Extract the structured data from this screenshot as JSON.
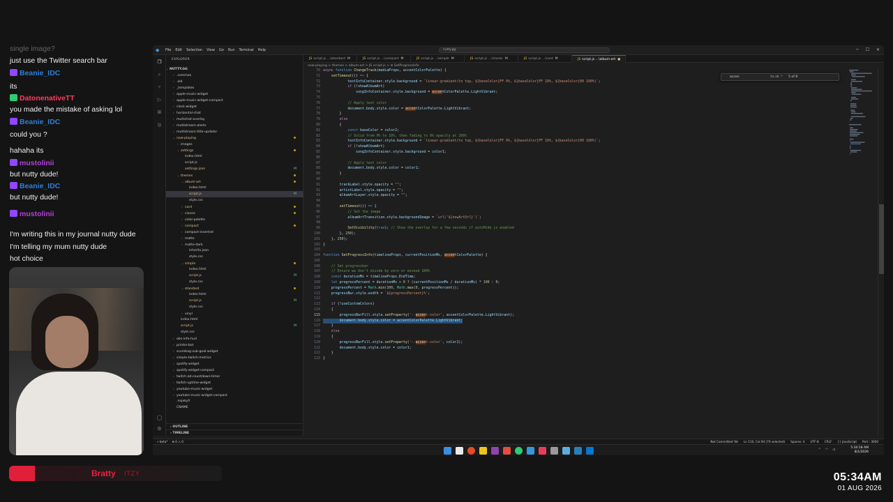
{
  "chat": {
    "messages": [
      {
        "user": "",
        "text": "single image?",
        "faded": true
      },
      {
        "user": "",
        "text": "just use the Twitter search bar"
      },
      {
        "user": "Beanie_IDC",
        "color": "#2e7fd9",
        "text": ""
      },
      {
        "user": "",
        "text": "its"
      },
      {
        "user": "DatonenativeTT",
        "color": "#ff3b5c",
        "text": ""
      },
      {
        "user": "",
        "text": "you made the mistake of asking lol"
      },
      {
        "user": "Beanie_IDC",
        "color": "#2e7fd9",
        "text": ""
      },
      {
        "user": "",
        "text": "could you ?"
      },
      {
        "user": "",
        "text": "hahaha its"
      },
      {
        "user": "mustolinii",
        "color": "#b43fd9",
        "text": ""
      },
      {
        "user": "",
        "text": "but nutty dude!"
      },
      {
        "user": "Beanie_IDC",
        "color": "#2e7fd9",
        "text": ""
      },
      {
        "user": "",
        "text": "but nutty dude!"
      },
      {
        "user": "mustolinii",
        "color": "#b43fd9",
        "text": ""
      },
      {
        "user": "",
        "text": "I'm writing this in my journal nutty dude"
      },
      {
        "user": "",
        "text": "I'm telling my mum nutty dude"
      },
      {
        "user": "",
        "text": "hot choice"
      }
    ]
  },
  "music": {
    "song": "Bratty",
    "artist": "ITZY"
  },
  "clock": {
    "time": "05:34AM",
    "date": "01 AUG 2026"
  },
  "vscode": {
    "menu": [
      "File",
      "Edit",
      "Selection",
      "View",
      "Go",
      "Run",
      "Terminal",
      "Help"
    ],
    "command_center": "nutty.gg",
    "explorer_title": "EXPLORER",
    "workspace": "NUTTY.GG",
    "tree": [
      {
        "label": ".common",
        "depth": 1,
        "folder": true
      },
      {
        "label": ".old",
        "depth": 1,
        "folder": true
      },
      {
        "label": "_templates",
        "depth": 1,
        "folder": true
      },
      {
        "label": "apple-music-widget",
        "depth": 1,
        "folder": true
      },
      {
        "label": "apple-music-widget-compact",
        "depth": 1,
        "folder": true
      },
      {
        "label": "clock-widget",
        "depth": 1,
        "folder": true
      },
      {
        "label": "horizontal-chat",
        "depth": 1,
        "folder": true
      },
      {
        "label": "multichat-overlay",
        "depth": 1,
        "folder": true
      },
      {
        "label": "multistream-alerts",
        "depth": 1,
        "folder": true
      },
      {
        "label": "multistream-title-updater",
        "depth": 1,
        "folder": true
      },
      {
        "label": "now-playing",
        "depth": 1,
        "folder": true,
        "open": true,
        "modified": true
      },
      {
        "label": "images",
        "depth": 2,
        "folder": true
      },
      {
        "label": "settings",
        "depth": 2,
        "folder": true,
        "open": true,
        "modified": true
      },
      {
        "label": "index.html",
        "depth": 3
      },
      {
        "label": "script.js",
        "depth": 3
      },
      {
        "label": "settings.json",
        "depth": 3,
        "modified": true,
        "badge": "M"
      },
      {
        "label": "themes",
        "depth": 2,
        "folder": true,
        "open": true,
        "modified": true
      },
      {
        "label": "album-art",
        "depth": 3,
        "folder": true,
        "open": true,
        "modified": true
      },
      {
        "label": "index.html",
        "depth": 4
      },
      {
        "label": "script.js",
        "depth": 4,
        "modified": true,
        "badge": "M",
        "selected": true
      },
      {
        "label": "style.css",
        "depth": 4
      },
      {
        "label": "card",
        "depth": 3,
        "folder": true,
        "modified": true
      },
      {
        "label": "classic",
        "depth": 3,
        "folder": true,
        "modified": true
      },
      {
        "label": "color-palette",
        "depth": 3,
        "folder": true
      },
      {
        "label": "compact",
        "depth": 3,
        "folder": true,
        "modified": true
      },
      {
        "label": "compact-inverted",
        "depth": 3,
        "folder": true
      },
      {
        "label": "matte",
        "depth": 3,
        "folder": true
      },
      {
        "label": "matte-dark",
        "depth": 3,
        "folder": true
      },
      {
        "label": "inherits.json",
        "depth": 4
      },
      {
        "label": "style.css",
        "depth": 4
      },
      {
        "label": "simple",
        "depth": 3,
        "folder": true,
        "open": true,
        "modified": true
      },
      {
        "label": "index.html",
        "depth": 4
      },
      {
        "label": "script.js",
        "depth": 4,
        "modified": true,
        "badge": "M"
      },
      {
        "label": "style.css",
        "depth": 4
      },
      {
        "label": "standard",
        "depth": 3,
        "folder": true,
        "open": true,
        "modified": true
      },
      {
        "label": "index.html",
        "depth": 4
      },
      {
        "label": "script.js",
        "depth": 4,
        "modified": true,
        "badge": "M"
      },
      {
        "label": "style.css",
        "depth": 4
      },
      {
        "label": "vinyl",
        "depth": 3,
        "folder": true
      },
      {
        "label": "index.html",
        "depth": 2
      },
      {
        "label": "script.js",
        "depth": 2,
        "modified": true,
        "badge": "M"
      },
      {
        "label": "style.css",
        "depth": 2
      },
      {
        "label": "obs-info-hud",
        "depth": 1,
        "folder": true
      },
      {
        "label": "printer-bot",
        "depth": 1,
        "folder": true
      },
      {
        "label": "scumbag-sub-goal-widget",
        "depth": 1,
        "folder": true
      },
      {
        "label": "simple-twitch-metrics",
        "depth": 1,
        "folder": true
      },
      {
        "label": "spotify-widget",
        "depth": 1,
        "folder": true
      },
      {
        "label": "spotify-widget-compact",
        "depth": 1,
        "folder": true
      },
      {
        "label": "twitch-ad-countdown-timer",
        "depth": 1,
        "folder": true
      },
      {
        "label": "twitch-uptime-widget",
        "depth": 1,
        "folder": true
      },
      {
        "label": "youtube-music-widget",
        "depth": 1,
        "folder": true
      },
      {
        "label": "youtube-music-widget-compact",
        "depth": 1,
        "folder": true
      },
      {
        "label": ".nojekyll",
        "depth": 1
      },
      {
        "label": "CNAME",
        "depth": 1
      }
    ],
    "outline_label": "OUTLINE",
    "timeline_label": "TIMELINE",
    "tabs": [
      {
        "label": "script.js",
        "path": "...\\standard",
        "mark": "M"
      },
      {
        "label": "script.js",
        "path": "...\\compact",
        "mark": "M"
      },
      {
        "label": "script.js",
        "path": "...\\simple",
        "mark": "M"
      },
      {
        "label": "script.js",
        "path": "...\\classic",
        "mark": "M"
      },
      {
        "label": "script.js",
        "path": "...\\card",
        "mark": "M"
      },
      {
        "label": "script.js",
        "path": "...\\album-art",
        "mark": "●",
        "active": true
      }
    ],
    "breadcrumb": "now-playing > themes > album-art > JS script.js > ⊘ SetProgressInfo",
    "find": {
      "query": "accen",
      "count": "5 of 8",
      "options": "Aa ab .*"
    },
    "status_left": [
      "⑂ beta*",
      "⊗ 0 ⚠ 0"
    ],
    "status_right": [
      "Not Committed Yet",
      "Ln 110, Col 94 (70 selected)",
      "Spaces: 4",
      "UTF-8",
      "CRLF",
      "{} JavaScript",
      "Port : 3000"
    ],
    "tray_time": "5:34:18 AM",
    "tray_date": "8/1/2026"
  },
  "code": [
    {
      "ln": "70",
      "html": "<span class='k'>async</span> <span class='b'>function</span> <span class='f'>ChangeTrack</span>(<span class='v'>mediaProps</span>, <span class='v'>accentColorPalette</span>) {"
    },
    {
      "ln": "71",
      "html": "    <span class='f'>setTimeout</span>(() <span class='b'>=&gt;</span> {"
    },
    {
      "ln": "72",
      "html": "            <span class='v'>textInfoContainer</span>.<span class='v'>style</span>.<span class='v'>background</span> = <span class='s'>`linear-gradient(to top, ${baseColor}FF 0%, ${baseColor}FF 10%, ${baseColor}00 100%)`</span>;"
    },
    {
      "ln": "73",
      "html": "            <span class='k'>if</span> (!<span class='v'>showAlbumArt</span>)"
    },
    {
      "ln": "74",
      "html": "                <span class='v'>songInfoContainer</span>.<span class='v'>style</span>.<span class='v'>background</span> = <span class='hl'>accen</span><span class='v'>tColorPalette</span>.<span class='v'>LightVibrant</span>;"
    },
    {
      "ln": "75",
      "html": ""
    },
    {
      "ln": "76",
      "html": "            <span class='c'>// Apply text color</span>"
    },
    {
      "ln": "77",
      "html": "            <span class='v'>document</span>.<span class='v'>body</span>.<span class='v'>style</span>.<span class='v'>color</span> = <span class='hl'>accen</span><span class='v'>tColorPalette</span>.<span class='v'>LightVibrant</span>;"
    },
    {
      "ln": "78",
      "html": "        }"
    },
    {
      "ln": "79",
      "html": "        <span class='k'>else</span>"
    },
    {
      "ln": "80",
      "html": "        {"
    },
    {
      "ln": "81",
      "html": "            <span class='b'>const</span> <span class='v'>baseColor</span> = <span class='v'>color2</span>;"
    },
    {
      "ln": "82",
      "html": "            <span class='c'>// Solid from 0% to 10%, then fading to 0% opacity at 100%</span>"
    },
    {
      "ln": "83",
      "html": "            <span class='v'>textInfoContainer</span>.<span class='v'>style</span>.<span class='v'>background</span> = <span class='s'>`linear-gradient(to top, ${baseColor}FF 0%, ${baseColor}FF 10%, ${baseColor}00 100%)`</span>;"
    },
    {
      "ln": "84",
      "html": "            <span class='k'>if</span> (!<span class='v'>showAlbumArt</span>)"
    },
    {
      "ln": "85",
      "html": "                <span class='v'>songInfoContainer</span>.<span class='v'>style</span>.<span class='v'>background</span> = <span class='v'>color1</span>;"
    },
    {
      "ln": "86",
      "html": ""
    },
    {
      "ln": "87",
      "html": "            <span class='c'>// Apply text color</span>"
    },
    {
      "ln": "88",
      "html": "            <span class='v'>document</span>.<span class='v'>body</span>.<span class='v'>style</span>.<span class='v'>color</span> = <span class='v'>color1</span>;"
    },
    {
      "ln": "89",
      "html": "        }"
    },
    {
      "ln": "90",
      "html": ""
    },
    {
      "ln": "91",
      "html": "        <span class='v'>trackLabel</span>.<span class='v'>style</span>.<span class='v'>opacity</span> = <span class='s'>\"\"</span>;"
    },
    {
      "ln": "92",
      "html": "        <span class='v'>artistLabel</span>.<span class='v'>style</span>.<span class='v'>opacity</span> = <span class='s'>\"\"</span>;"
    },
    {
      "ln": "93",
      "html": "        <span class='v'>albumArtLayer</span>.<span class='v'>style</span>.<span class='v'>opacity</span> = <span class='s'>\"\"</span>;"
    },
    {
      "ln": "94",
      "html": ""
    },
    {
      "ln": "95",
      "html": "        <span class='f'>setTimeout</span>(() <span class='b'>=&gt;</span> {"
    },
    {
      "ln": "96",
      "html": "            <span class='c'>// Set the image</span>"
    },
    {
      "ln": "97",
      "html": "            <span class='v'>albumArtTransition</span>.<span class='v'>style</span>.<span class='v'>backgroundImage</span> = <span class='s'>`url('${newArtUrl}')`</span>;"
    },
    {
      "ln": "98",
      "html": ""
    },
    {
      "ln": "99",
      "html": "            <span class='f'>SetVisibility</span>(<span class='b'>true</span>); <span class='c'>// Show the overlay for a few seconds if autoHide is enabled</span>"
    },
    {
      "ln": "100",
      "html": "        }, <span class='n'>250</span>);"
    },
    {
      "ln": "101",
      "html": "    }, <span class='n'>250</span>);"
    },
    {
      "ln": "102",
      "html": "}"
    },
    {
      "ln": "103",
      "html": ""
    },
    {
      "ln": "104",
      "html": "<span class='b'>function</span> <span class='f'>SetProgressInfo</span>(<span class='v'>timelineProps</span>, <span class='v'>currentPositionMs</span>, <span class='hl'>accen</span><span class='v'>tColorPalette</span>) {"
    },
    {
      "ln": "105",
      "html": ""
    },
    {
      "ln": "106",
      "html": "    <span class='c'>// Set progressbar</span>"
    },
    {
      "ln": "107",
      "html": "    <span class='c'>// Ensure we don't divide by zero or exceed 100%</span>"
    },
    {
      "ln": "108",
      "html": "    <span class='b'>const</span> <span class='v'>durationMs</span> = <span class='v'>timelineProps</span>.<span class='v'>EndTime</span>;"
    },
    {
      "ln": "109",
      "html": "    <span class='b'>let</span> <span class='v'>progressPercent</span> = <span class='v'>durationMs</span> &gt; <span class='n'>0</span> ? (<span class='v'>currentPositionMs</span> / <span class='v'>durationMs</span>) * <span class='n'>100</span> : <span class='n'>0</span>;"
    },
    {
      "ln": "110",
      "html": "    <span class='v'>progressPercent</span> = <span class='t'>Math</span>.<span class='f'>min</span>(<span class='n'>100</span>, <span class='t'>Math</span>.<span class='f'>max</span>(<span class='n'>0</span>, <span class='v'>progressPercent</span>));"
    },
    {
      "ln": "111",
      "html": "    <span class='v'>progressBar</span>.<span class='v'>style</span>.<span class='v'>width</span> = <span class='s'>`${progressPercent}%`</span>;"
    },
    {
      "ln": "112",
      "html": ""
    },
    {
      "ln": "113",
      "html": "    <span class='k'>if</span> (!<span class='v'>useCustomColors</span>)"
    },
    {
      "ln": "114",
      "html": "    {"
    },
    {
      "ln": "115",
      "html": "        <span class='v'>progressBarFill</span>.<span class='v'>style</span>.<span class='f'>setProperty</span>(<span class='s'>'--</span><span class='hl'>accen</span><span class='s'>t-color'</span>, <span class='v'>accentColorPalette</span>.<span class='v'>LightVibrant</span>);"
    },
    {
      "ln": "116",
      "html": "        <span class='v'>document</span>.<span class='v'>body</span>.<span class='v'>style</span>.<span class='v'>color</span> = <span class='v'>accentColorPalette</span>.<span class='v'>LightVibrant</span>;",
      "sel": true
    },
    {
      "ln": "117",
      "html": "    }"
    },
    {
      "ln": "118",
      "html": "    <span class='k'>else</span>"
    },
    {
      "ln": "119",
      "html": "    {"
    },
    {
      "ln": "120",
      "html": "        <span class='v'>progressBarFill</span>.<span class='v'>style</span>.<span class='f'>setProperty</span>(<span class='s'>'--</span><span class='hl'>accen</span><span class='s'>t-color'</span>, <span class='v'>color1</span>);"
    },
    {
      "ln": "121",
      "html": "        <span class='v'>document</span>.<span class='v'>body</span>.<span class='v'>style</span>.<span class='v'>color</span> = <span class='v'>color1</span>;"
    },
    {
      "ln": "122",
      "html": "    }"
    },
    {
      "ln": "123",
      "html": "}"
    }
  ]
}
